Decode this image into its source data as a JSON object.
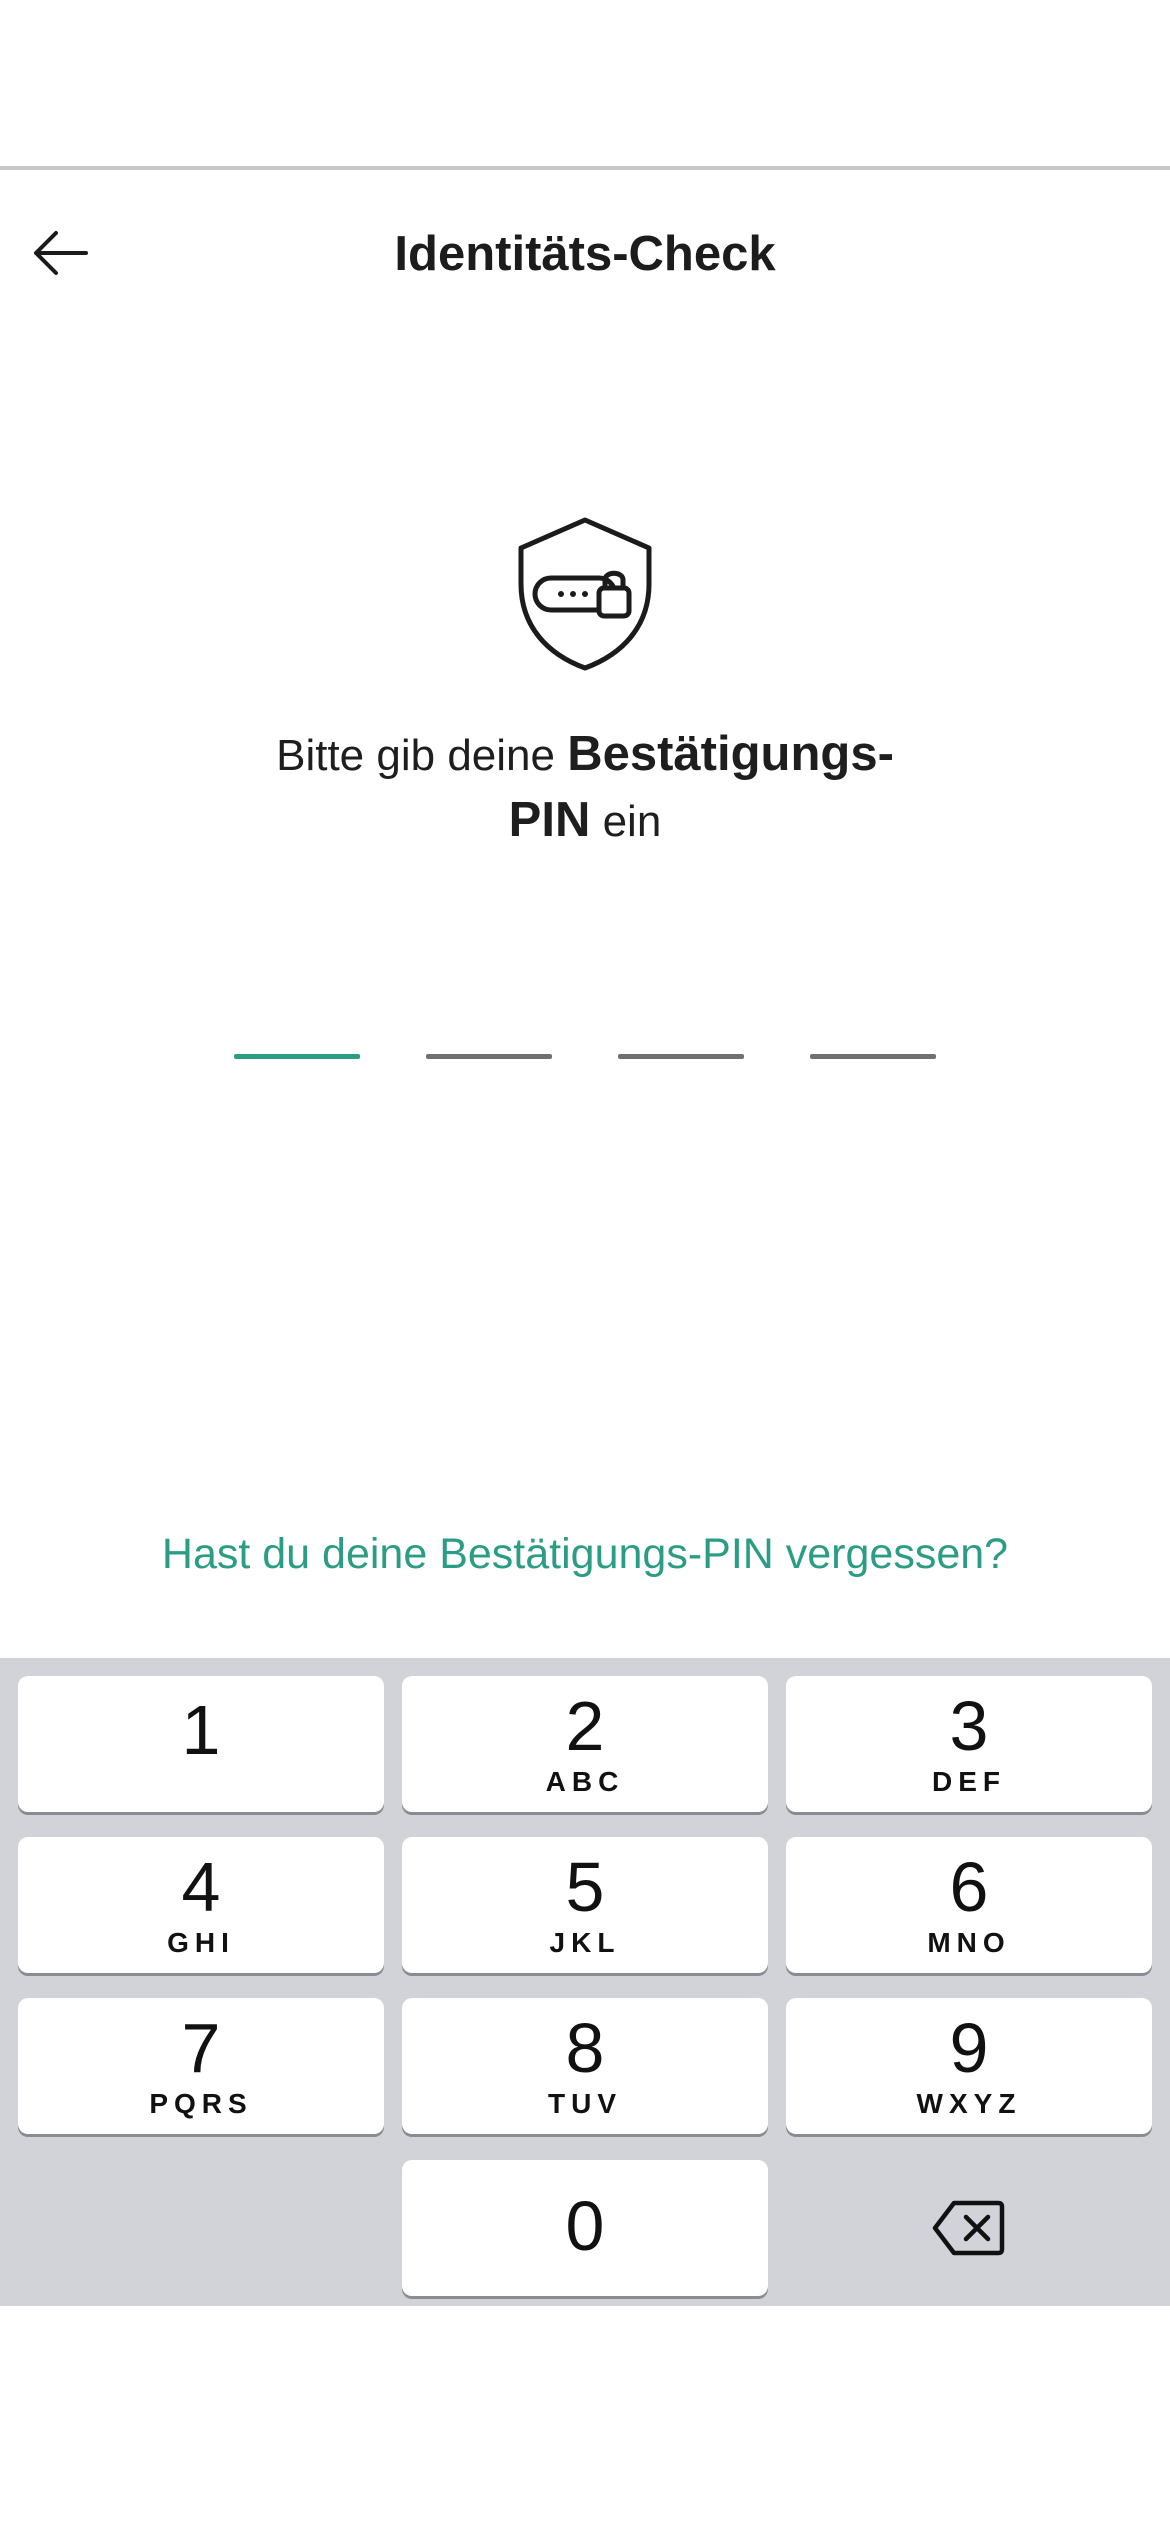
{
  "header": {
    "title": "Identitäts-Check",
    "back_icon": "arrow-left-icon"
  },
  "illustration": {
    "icon": "shield-lock-icon"
  },
  "prompt": {
    "text_before": "Bitte gib deine ",
    "bold_1": "Bestätigungs-",
    "bold_2": "PIN",
    "text_after": " ein"
  },
  "pin": {
    "length": 4,
    "entered": 0,
    "active_color": "#2b9d84",
    "inactive_color": "#707070"
  },
  "forgot_link": "Hast du deine Bestätigungs-PIN vergessen?",
  "keypad": {
    "keys": [
      {
        "digit": "1",
        "letters": ""
      },
      {
        "digit": "2",
        "letters": "ABC"
      },
      {
        "digit": "3",
        "letters": "DEF"
      },
      {
        "digit": "4",
        "letters": "GHI"
      },
      {
        "digit": "5",
        "letters": "JKL"
      },
      {
        "digit": "6",
        "letters": "MNO"
      },
      {
        "digit": "7",
        "letters": "PQRS"
      },
      {
        "digit": "8",
        "letters": "TUV"
      },
      {
        "digit": "9",
        "letters": "WXYZ"
      },
      {
        "digit": "0",
        "letters": ""
      }
    ],
    "delete_icon": "backspace-icon",
    "background": "#d1d3d9"
  }
}
